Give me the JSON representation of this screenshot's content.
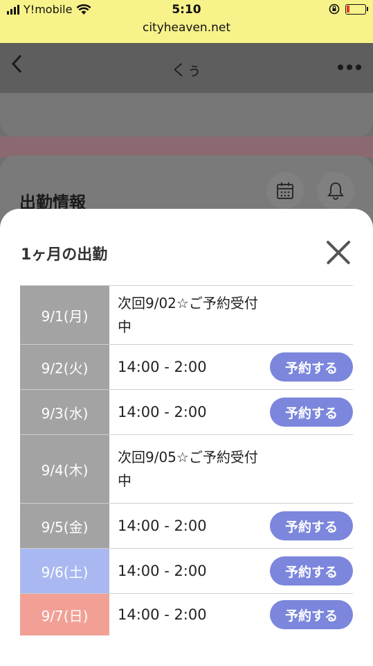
{
  "status_bar": {
    "carrier": "Y!mobile",
    "time": "5:10",
    "url": "cityheaven.net"
  },
  "background_page": {
    "title": "くぅ",
    "section_label": "出勤情報"
  },
  "modal": {
    "title": "1ヶ月の出勤",
    "schedule": [
      {
        "date": "9/1(月)",
        "note": "次回9/02☆ご予約受付中",
        "day_type": "weekday"
      },
      {
        "date": "9/2(火)",
        "hours": "14:00 - 2:00",
        "button": "予約する",
        "day_type": "weekday"
      },
      {
        "date": "9/3(水)",
        "hours": "14:00 - 2:00",
        "button": "予約する",
        "day_type": "weekday"
      },
      {
        "date": "9/4(木)",
        "note": "次回9/05☆ご予約受付中",
        "day_type": "weekday"
      },
      {
        "date": "9/5(金)",
        "hours": "14:00 - 2:00",
        "button": "予約する",
        "day_type": "weekday"
      },
      {
        "date": "9/6(土)",
        "hours": "14:00 - 2:00",
        "button": "予約する",
        "day_type": "saturday"
      },
      {
        "date": "9/7(日)",
        "hours": "14:00 - 2:00",
        "button": "予約する",
        "day_type": "sunday"
      }
    ]
  },
  "colors": {
    "status_bar_bg": "#f7f28a",
    "weekday_date_bg": "#a3a3a3",
    "saturday_date_bg": "#a9b8f0",
    "sunday_date_bg": "#f2a095",
    "reserve_button": "#7b86dc"
  }
}
